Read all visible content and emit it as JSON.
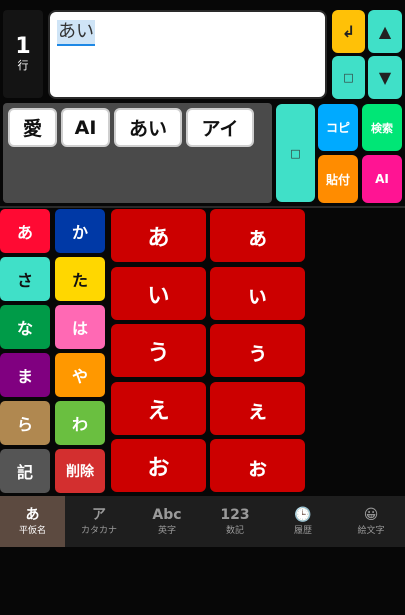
{
  "row_indicator": {
    "number": "1",
    "label": "行"
  },
  "text_area": {
    "value": "あい"
  },
  "top_buttons": {
    "enter": "↲",
    "up": "▲",
    "space_small": "□",
    "down": "▼"
  },
  "candidates": [
    "愛",
    "AI",
    "あい",
    "アイ"
  ],
  "actions": {
    "space": "□",
    "copy": "コピ",
    "search": "検索",
    "paste": "貼付",
    "ai": "AI"
  },
  "row_keys": [
    {
      "label": "あ",
      "color": "#ff0a33"
    },
    {
      "label": "か",
      "color": "#0039a6"
    },
    {
      "label": "さ",
      "color": "#40e0c8"
    },
    {
      "label": "た",
      "color": "#ffd700"
    },
    {
      "label": "な",
      "color": "#009b48"
    },
    {
      "label": "は",
      "color": "#ff69b4"
    },
    {
      "label": "ま",
      "color": "#800080"
    },
    {
      "label": "や",
      "color": "#ff9800"
    },
    {
      "label": "ら",
      "color": "#b08850"
    },
    {
      "label": "わ",
      "color": "#6abf40"
    },
    {
      "label": "記",
      "color": "#555555"
    },
    {
      "label": "削除",
      "color": "#d32f2f"
    }
  ],
  "kana_keys": [
    [
      "あ",
      "ぁ"
    ],
    [
      "い",
      "ぃ"
    ],
    [
      "う",
      "ぅ"
    ],
    [
      "え",
      "ぇ"
    ],
    [
      "お",
      "ぉ"
    ]
  ],
  "tabs": [
    {
      "icon": "あ",
      "label": "平仮名",
      "active": true
    },
    {
      "icon": "ア",
      "label": "カタカナ",
      "active": false
    },
    {
      "icon": "Abc",
      "label": "英字",
      "active": false
    },
    {
      "icon": "123",
      "label": "数記",
      "active": false
    },
    {
      "icon": "🕒",
      "label": "履歴",
      "active": false
    },
    {
      "icon": "😀",
      "label": "絵文字",
      "active": false
    }
  ]
}
